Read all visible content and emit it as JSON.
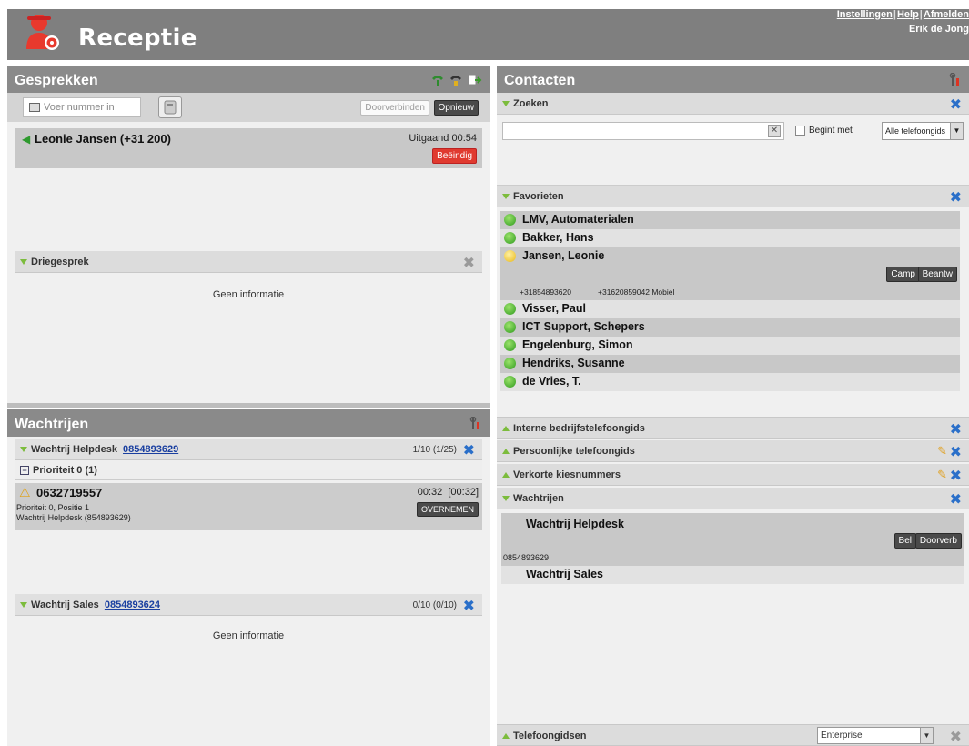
{
  "header": {
    "title": "Receptie",
    "links": [
      "Instellingen",
      "Help",
      "Afmelden"
    ],
    "user": "Erik de Jong"
  },
  "calls": {
    "title": "Gesprekken",
    "number_placeholder": "Voer nummer in",
    "transfer_label": "Doorverbinden",
    "redial_label": "Opnieuw",
    "active_call": {
      "name": "Leonie Jansen (+31 200)",
      "status": "Uitgaand 00:54",
      "end_label": "Beëindig"
    },
    "conference": {
      "title": "Driegesprek",
      "empty": "Geen informatie"
    }
  },
  "queues": {
    "title": "Wachtrijen",
    "helpdesk": {
      "label": "Wachtrij Helpdesk",
      "number": "0854893629",
      "count": "1/10 (1/25)",
      "priority": "Prioriteit 0 (1)",
      "caller": "0632719557",
      "time": "00:32  [00:32]",
      "detail1": "Prioriteit 0, Positie 1",
      "detail2": "Wachtrij Helpdesk (854893629)",
      "take_label": "OVERNEMEN"
    },
    "sales": {
      "label": "Wachtrij Sales",
      "number": "0854893624",
      "count": "0/10 (0/10)",
      "empty": "Geen informatie"
    }
  },
  "contacts": {
    "title": "Contacten",
    "search": {
      "title": "Zoeken",
      "starts_with": "Begint met",
      "directory_select": "Alle telefoongids"
    },
    "favorites": {
      "title": "Favorieten",
      "items": [
        {
          "name": "LMV, Automaterialen",
          "status": "green"
        },
        {
          "name": "Bakker, Hans",
          "status": "green"
        },
        {
          "name": "Jansen, Leonie",
          "status": "yellow"
        },
        {
          "name": "Visser, Paul",
          "status": "green"
        },
        {
          "name": "ICT Support, Schepers",
          "status": "green"
        },
        {
          "name": "Engelenburg, Simon",
          "status": "green"
        },
        {
          "name": "Hendriks, Susanne",
          "status": "green"
        },
        {
          "name": "de Vries, T.",
          "status": "green"
        }
      ],
      "expanded": {
        "phone": "+31854893620",
        "mobile": "+31620859042 Mobiel",
        "camp_label": "Camp",
        "answer_label": "Beantw"
      }
    },
    "sections": {
      "internal": "Interne bedrijfstelefoongids",
      "personal": "Persoonlijke telefoongids",
      "speed": "Verkorte kiesnummers",
      "queues": "Wachtrijen",
      "phonebooks": "Telefoongidsen"
    },
    "queue_items": {
      "helpdesk_name": "Wachtrij Helpdesk",
      "helpdesk_number": "0854893629",
      "call_label": "Bel",
      "forward_label": "Doorverb",
      "sales_name": "Wachtrij Sales"
    },
    "phonebook_select": "Enterprise"
  }
}
